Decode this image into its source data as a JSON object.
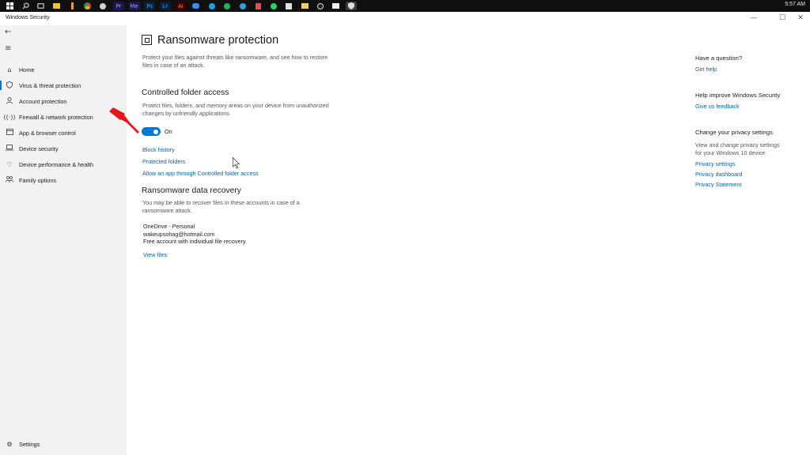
{
  "taskbar": {
    "clock": "5:57 AM",
    "icons": [
      "windows-start-icon",
      "search-icon",
      "task-view-icon",
      "file-explorer-icon",
      "outlook-icon",
      "chrome-icon",
      "rocket-icon",
      "premiere-icon",
      "media-encoder-icon",
      "photoshop-icon",
      "lightroom-icon",
      "illustrator-icon",
      "weather-icon",
      "clipchamp-icon",
      "spotify-icon",
      "telegram-icon",
      "scissors-icon",
      "whatsapp-icon",
      "store-icon",
      "folder-icon",
      "obs-icon",
      "image-icon",
      "windows-security-icon"
    ],
    "labels": {
      "ps": "Ps",
      "pr": "Pr",
      "me": "Me",
      "lr": "Lr",
      "ai": "Ai"
    }
  },
  "window": {
    "title": "Windows Security",
    "minimize": "—",
    "maximize": "☐",
    "close": "✕"
  },
  "sidebar": {
    "back_glyph": "←",
    "menu_glyph": "≡",
    "items": [
      {
        "label": "Home",
        "icon": "home-icon"
      },
      {
        "label": "Virus & threat protection",
        "icon": "shield-icon"
      },
      {
        "label": "Account protection",
        "icon": "person-icon"
      },
      {
        "label": "Firewall & network protection",
        "icon": "wifi-icon"
      },
      {
        "label": "App & browser control",
        "icon": "app-window-icon"
      },
      {
        "label": "Device security",
        "icon": "laptop-icon"
      },
      {
        "label": "Device performance & health",
        "icon": "heart-icon"
      },
      {
        "label": "Family options",
        "icon": "family-icon"
      }
    ],
    "settings_label": "Settings"
  },
  "main": {
    "title": "Ransomware protection",
    "intro_line1": "Protect your files against threats like ransomware, and see how to restore",
    "intro_line2": "files in case of an attack.",
    "cfa": {
      "heading": "Controlled folder access",
      "desc_line1": "Protect files, folders, and memory areas on your device from unauthorized",
      "desc_line2": "changes by unfriendly applications.",
      "toggle_state": "On",
      "links": [
        "Block history",
        "Protected folders",
        "Allow an app through Controlled folder access"
      ]
    },
    "recovery": {
      "heading": "Ransomware data recovery",
      "desc_line1": "You may be able to recover files in these accounts in case of a",
      "desc_line2": "ransomware attack.",
      "account_name": "OneDrive - Personal",
      "account_email": "wakeupsohag@hotmail.com",
      "account_desc": "Free account with individual file recovery.",
      "view_files": "View files"
    }
  },
  "right_panel": {
    "question_heading": "Have a question?",
    "get_help": "Get help",
    "improve_heading": "Help improve Windows Security",
    "give_feedback": "Give us feedback",
    "privacy_heading": "Change your privacy settings",
    "privacy_desc_line1": "View and change privacy settings",
    "privacy_desc_line2": "for your Windows 10 device.",
    "privacy_links": [
      "Privacy settings",
      "Privacy dashboard",
      "Privacy Statement"
    ]
  },
  "colors": {
    "accent": "#0078d7",
    "link": "#0063b1",
    "annotation_arrow": "#e8161b"
  }
}
